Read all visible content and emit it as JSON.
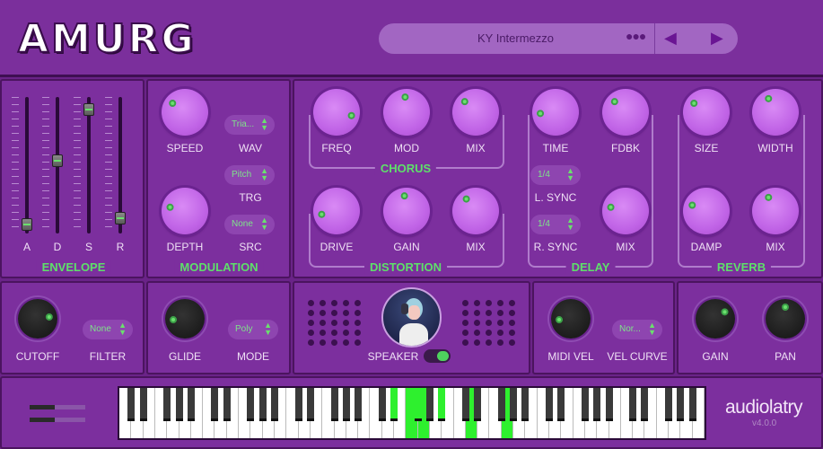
{
  "header": {
    "logo": "AMURG",
    "preset": "KY Intermezzo",
    "more_icon": "ellipsis-icon",
    "prev_icon": "triangle-left",
    "next_icon": "triangle-right"
  },
  "colors": {
    "accent": "#5ee06a",
    "background": "#7c2f9e",
    "knob": "#c063e6"
  },
  "envelope": {
    "title": "ENVELOPE",
    "faders": [
      {
        "label": "A",
        "value": 0.05
      },
      {
        "label": "D",
        "value": 0.55
      },
      {
        "label": "S",
        "value": 0.95
      },
      {
        "label": "R",
        "value": 0.1
      }
    ]
  },
  "modulation": {
    "title": "MODULATION",
    "speed": {
      "label": "SPEED",
      "value": 0.3
    },
    "depth": {
      "label": "DEPTH",
      "value": 0.22
    },
    "wav": {
      "label": "WAV",
      "value": "Tria..."
    },
    "trg": {
      "label": "TRG",
      "value": "Pitch"
    },
    "src": {
      "label": "SRC",
      "value": "None"
    }
  },
  "chorus": {
    "title": "CHORUS",
    "freq": {
      "label": "FREQ",
      "value": 0.88
    },
    "mod": {
      "label": "MOD",
      "value": 0.48
    },
    "mix": {
      "label": "MIX",
      "value": 0.33
    }
  },
  "distortion": {
    "title": "DISTORTION",
    "drive": {
      "label": "DRIVE",
      "value": 0.12
    },
    "gain": {
      "label": "GAIN",
      "value": 0.47
    },
    "mix": {
      "label": "MIX",
      "value": 0.36
    }
  },
  "delay": {
    "title": "DELAY",
    "time": {
      "label": "TIME",
      "value": 0.15
    },
    "fdbk": {
      "label": "FDBK",
      "value": 0.33
    },
    "lsync": {
      "label": "L. SYNC",
      "value": "1/4"
    },
    "rsync": {
      "label": "R. SYNC",
      "value": "1/4"
    },
    "mix": {
      "label": "MIX",
      "value": 0.22
    }
  },
  "reverb": {
    "title": "REVERB",
    "size": {
      "label": "SIZE",
      "value": 0.3
    },
    "width": {
      "label": "WIDTH",
      "value": 0.4
    },
    "damp": {
      "label": "DAMP",
      "value": 0.25
    },
    "mix": {
      "label": "MIX",
      "value": 0.4
    }
  },
  "filter": {
    "cutoff": {
      "label": "CUTOFF",
      "value": 0.8
    },
    "filter": {
      "label": "FILTER",
      "value": "None"
    }
  },
  "voice": {
    "glide": {
      "label": "GLIDE",
      "value": 0.15
    },
    "mode": {
      "label": "MODE",
      "value": "Poly"
    }
  },
  "speaker": {
    "label": "SPEAKER",
    "toggle_on": true
  },
  "velocity": {
    "midi_vel": {
      "label": "MIDI VEL",
      "value": 0.15
    },
    "vel_curve": {
      "label": "VEL CURVE",
      "value": "Nor..."
    }
  },
  "output": {
    "gain": {
      "label": "GAIN",
      "value": 0.7
    },
    "pan": {
      "label": "PAN",
      "value": 0.5
    }
  },
  "keyboard": {
    "octaves": 7,
    "pressed": [
      "D#3",
      "F3",
      "F#3",
      "G3",
      "A#3",
      "D4",
      "G4"
    ]
  },
  "brand": {
    "name": "audiolatry",
    "version": "v4.0.0"
  }
}
